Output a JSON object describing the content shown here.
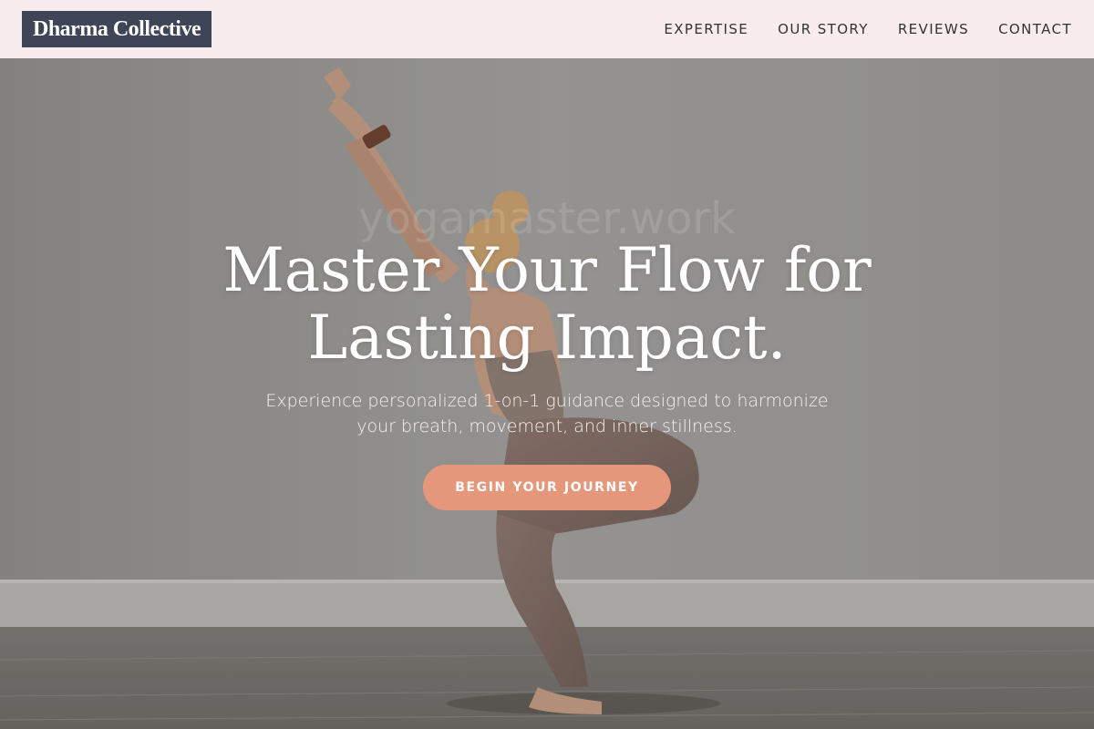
{
  "brand": {
    "name": "Dharma Collective"
  },
  "nav": {
    "items": [
      {
        "label": "EXPERTISE"
      },
      {
        "label": "OUR STORY"
      },
      {
        "label": "REVIEWS"
      },
      {
        "label": "CONTACT"
      }
    ]
  },
  "hero": {
    "title_line1": "Master Your Flow for",
    "title_line2": "Lasting Impact.",
    "watermark": "yogamaster.work",
    "subtitle_line1": "Experience personalized 1-on-1 guidance designed to harmonize",
    "subtitle_line2": "your breath, movement, and inner stillness.",
    "cta_label": "BEGIN YOUR JOURNEY",
    "image_subject": "woman-in-chair-pose-photo"
  },
  "colors": {
    "header_bg": "#f9ecec",
    "logo_bg": "#3d4556",
    "cta_bg": "#e5977b",
    "nav_text": "#333333"
  }
}
